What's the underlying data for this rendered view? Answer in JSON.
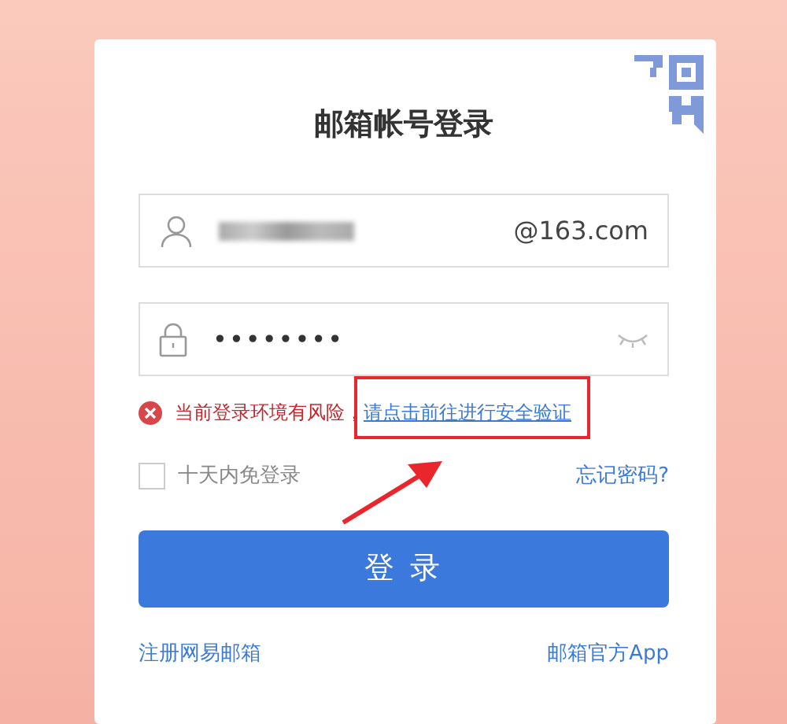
{
  "login_card": {
    "title": "邮箱帐号登录",
    "username_field": {
      "suffix": "@163.com"
    },
    "password_field": {
      "value": "••••••••"
    },
    "error_message": {
      "text": "当前登录环境有风险，",
      "link": "请点击前往进行安全验证"
    },
    "remember_checkbox": {
      "label": "十天内免登录",
      "checked": false
    },
    "forgot_password_link": "忘记密码?",
    "login_button": "登 录",
    "footer_links": [
      "注册网易邮箱",
      "邮箱官方App"
    ]
  }
}
